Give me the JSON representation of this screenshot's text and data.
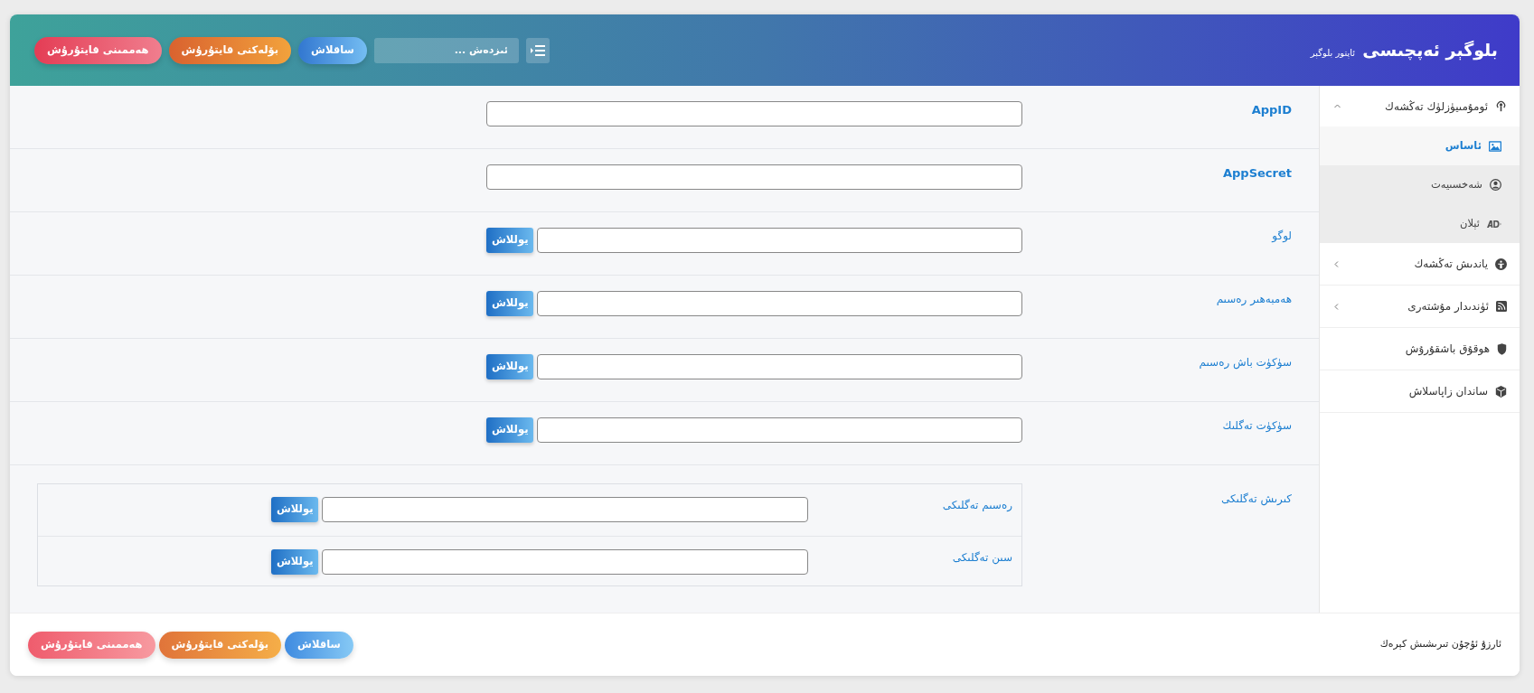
{
  "header": {
    "title": "بلوگېر ئەپچىسى",
    "subtitle": "ئاپتور بلوگېر",
    "search": {
      "placeholder": "ئىزدەش ..."
    },
    "buttons": [
      {
        "label": "ساقلاش",
        "kind": "save"
      },
      {
        "label": "بۆلەكنى قايتۇرۇش",
        "kind": "reset-section"
      },
      {
        "label": "ھەممىنى قايتۇرۇش",
        "kind": "reset-all"
      }
    ]
  },
  "sidebar": {
    "items": [
      {
        "label": "ئومۇمىيۈزلۈك تەڭشەك",
        "expanded": true,
        "children": [
          {
            "label": "ئاساس",
            "selected": true
          },
          {
            "label": "شەخسىيەت",
            "selected": false
          },
          {
            "label": "ئېلان",
            "selected": false
          }
        ]
      },
      {
        "label": "ياندىش تەڭشەك",
        "expanded": false
      },
      {
        "label": "ئۈندىدار مۇشتەرى",
        "expanded": false
      },
      {
        "label": "ھوقۇق باشقۇرۇش"
      },
      {
        "label": "ساندان زاپاسلاش"
      }
    ]
  },
  "form": {
    "fields": [
      {
        "label": "AppID",
        "kind": "text"
      },
      {
        "label": "AppSecret",
        "kind": "text"
      },
      {
        "label": "لوگو",
        "kind": "upload",
        "button": "يوللاش"
      },
      {
        "label": "ھەمبەھىر رەسىم",
        "kind": "upload",
        "button": "يوللاش"
      },
      {
        "label": "سۈكۈت باش رەسىم",
        "kind": "upload",
        "button": "يوللاش"
      },
      {
        "label": "سۈكۈت تەگلىك",
        "kind": "upload",
        "button": "يوللاش"
      },
      {
        "label": "كىرىش تەگلىكى",
        "kind": "group",
        "fields": [
          {
            "label": "رەسىم تەگلىكى",
            "kind": "upload",
            "button": "يوللاش"
          },
          {
            "label": "سىن تەگلىكى",
            "kind": "upload",
            "button": "يوللاش"
          }
        ]
      }
    ]
  },
  "footer": {
    "text": "ئارزۇ ئۇچۇن تىرىشىش كېرەك",
    "buttons": [
      {
        "label": "ساقلاش",
        "kind": "save"
      },
      {
        "label": "بۆلەكنى قايتۇرۇش",
        "kind": "reset-section"
      },
      {
        "label": "ھەممىنى قايتۇرۇش",
        "kind": "reset-all"
      }
    ]
  }
}
